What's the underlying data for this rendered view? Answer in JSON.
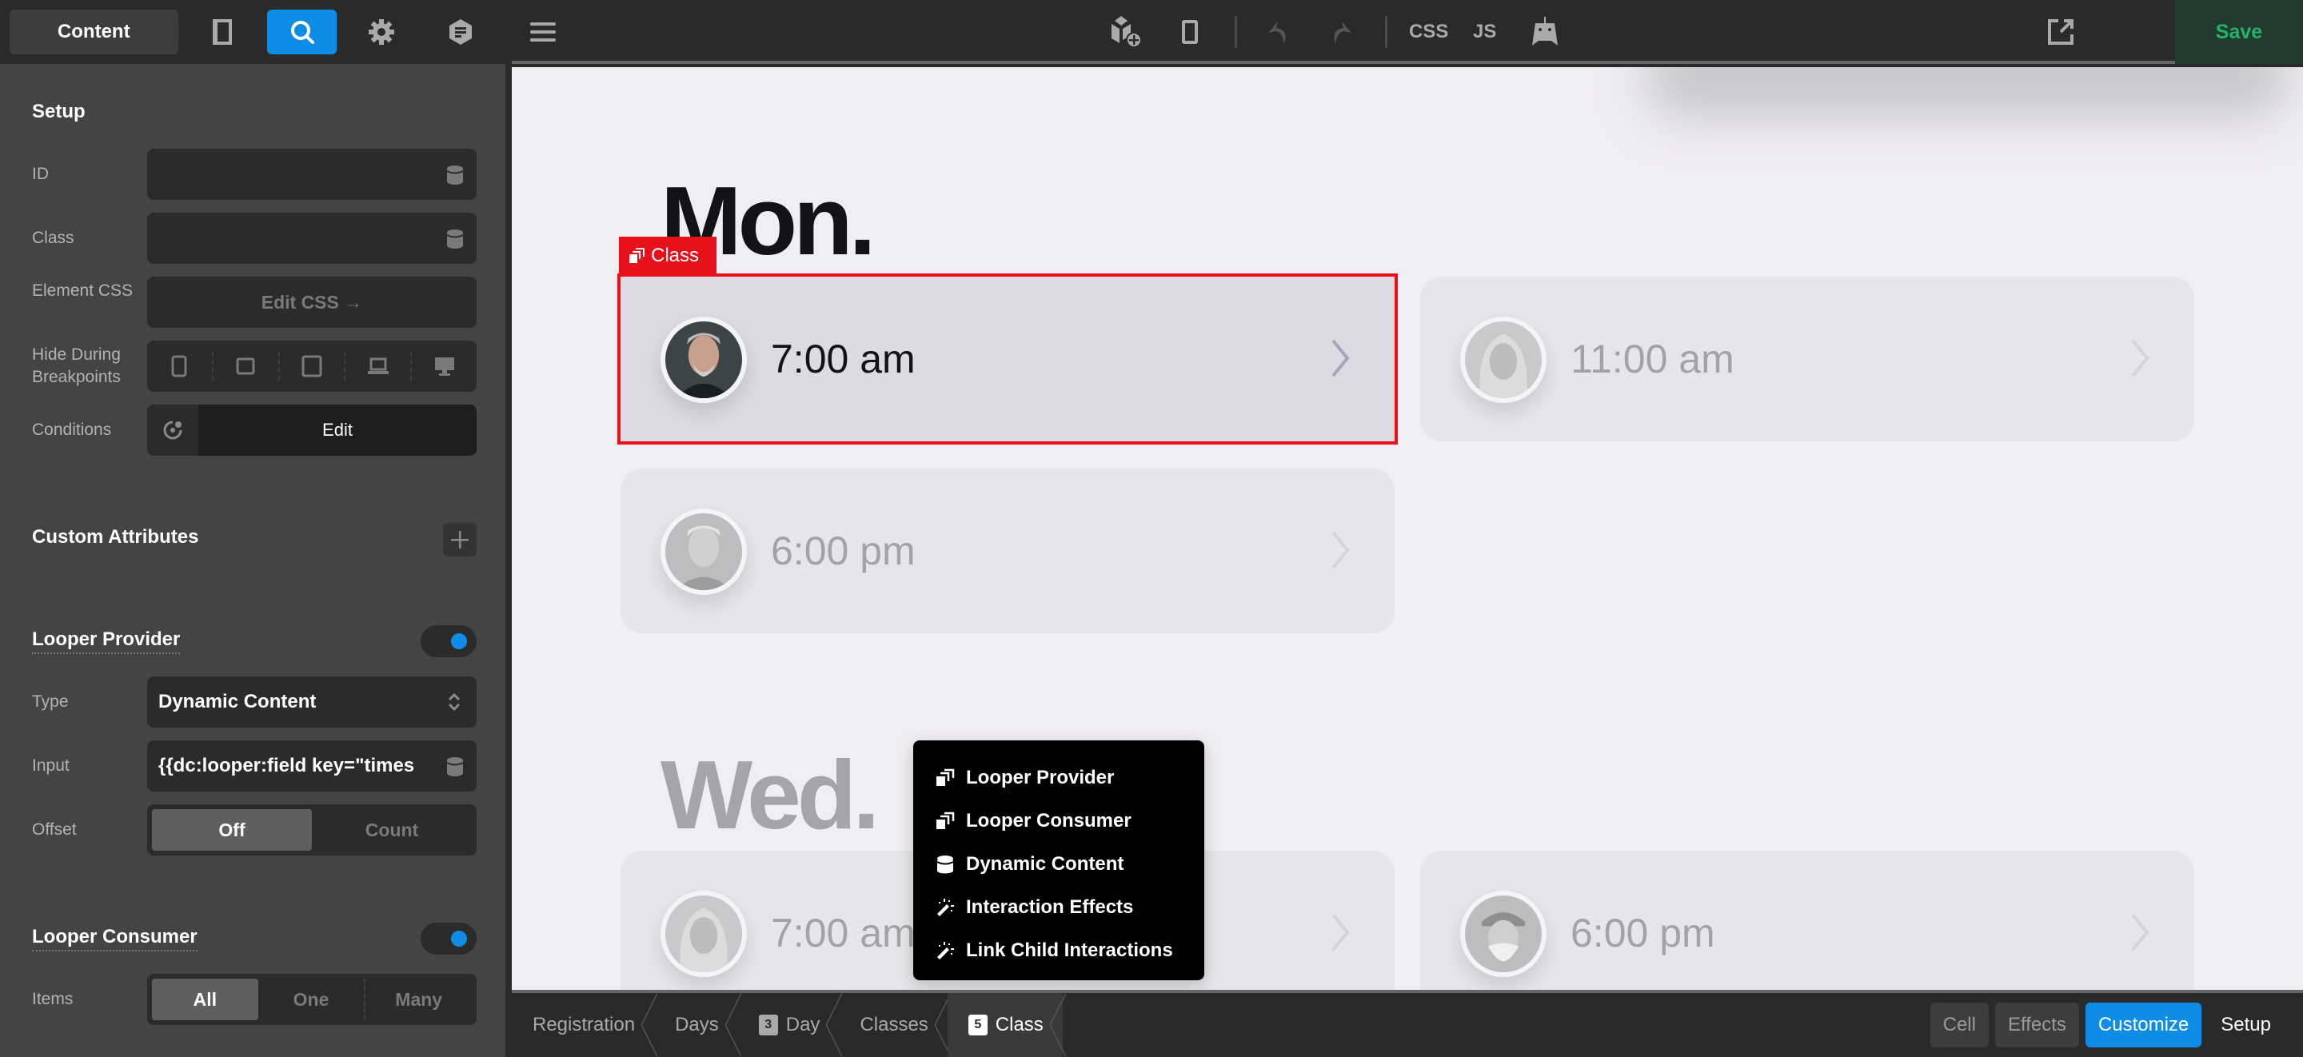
{
  "sidebar": {
    "top": {
      "content_label": "Content",
      "icons": [
        "layout-panel-icon",
        "search-icon",
        "gear-icon",
        "docs-hex-icon"
      ],
      "active_icon": "search-icon"
    },
    "setup": {
      "title": "Setup",
      "id_label": "ID",
      "id_value": "",
      "class_label": "Class",
      "class_value": "",
      "element_css_label": "Element CSS",
      "edit_css_label": "Edit CSS →",
      "hide_label": "Hide During Breakpoints",
      "breakpoints": [
        "phone",
        "tablet-small",
        "tablet",
        "laptop",
        "desktop"
      ],
      "conditions_label": "Conditions",
      "conditions_edit": "Edit"
    },
    "custom_attributes": {
      "title": "Custom Attributes"
    },
    "looper_provider": {
      "title": "Looper Provider",
      "enabled": true,
      "type_label": "Type",
      "type_value": "Dynamic Content",
      "input_label": "Input",
      "input_value": "{{dc:looper:field key=\"times",
      "offset_label": "Offset",
      "offset_options": [
        "Off",
        "Count"
      ],
      "offset_selected": "Off"
    },
    "looper_consumer": {
      "title": "Looper Consumer",
      "enabled": true,
      "items_label": "Items",
      "items_options": [
        "All",
        "One",
        "Many"
      ],
      "items_selected": "All"
    }
  },
  "topbar": {
    "menu_icon": "hamburger-icon",
    "css_label": "CSS",
    "js_label": "JS",
    "save_label": "Save",
    "colors": {
      "save_text": "#22b36b",
      "accent": "#0e8de6"
    }
  },
  "canvas": {
    "selected_tag": "Class",
    "days": [
      {
        "title": "Mon.",
        "classes": [
          {
            "time": "7:00 am",
            "selected": true
          },
          {
            "time": "11:00 am",
            "selected": false
          },
          {
            "time": "6:00 pm",
            "selected": false
          }
        ]
      },
      {
        "title": "Wed.",
        "classes": [
          {
            "time": "7:00 am",
            "selected": false
          },
          {
            "time": "6:00 pm",
            "selected": false
          }
        ]
      }
    ],
    "popup_menu": [
      {
        "label": "Looper Provider",
        "icon": "looper-icon"
      },
      {
        "label": "Looper Consumer",
        "icon": "looper-icon"
      },
      {
        "label": "Dynamic Content",
        "icon": "database-icon"
      },
      {
        "label": "Interaction Effects",
        "icon": "magic-wand-icon"
      },
      {
        "label": "Link Child Interactions",
        "icon": "magic-wand-icon"
      }
    ]
  },
  "bottombar": {
    "breadcrumbs": [
      {
        "label": "Registration",
        "badge": null
      },
      {
        "label": "Days",
        "badge": null
      },
      {
        "label": "Day",
        "badge": "3"
      },
      {
        "label": "Classes",
        "badge": null
      },
      {
        "label": "Class",
        "badge": "5",
        "active": true
      }
    ],
    "tabs": [
      "Cell",
      "Effects",
      "Customize",
      "Setup"
    ],
    "active_tab": "Customize"
  }
}
